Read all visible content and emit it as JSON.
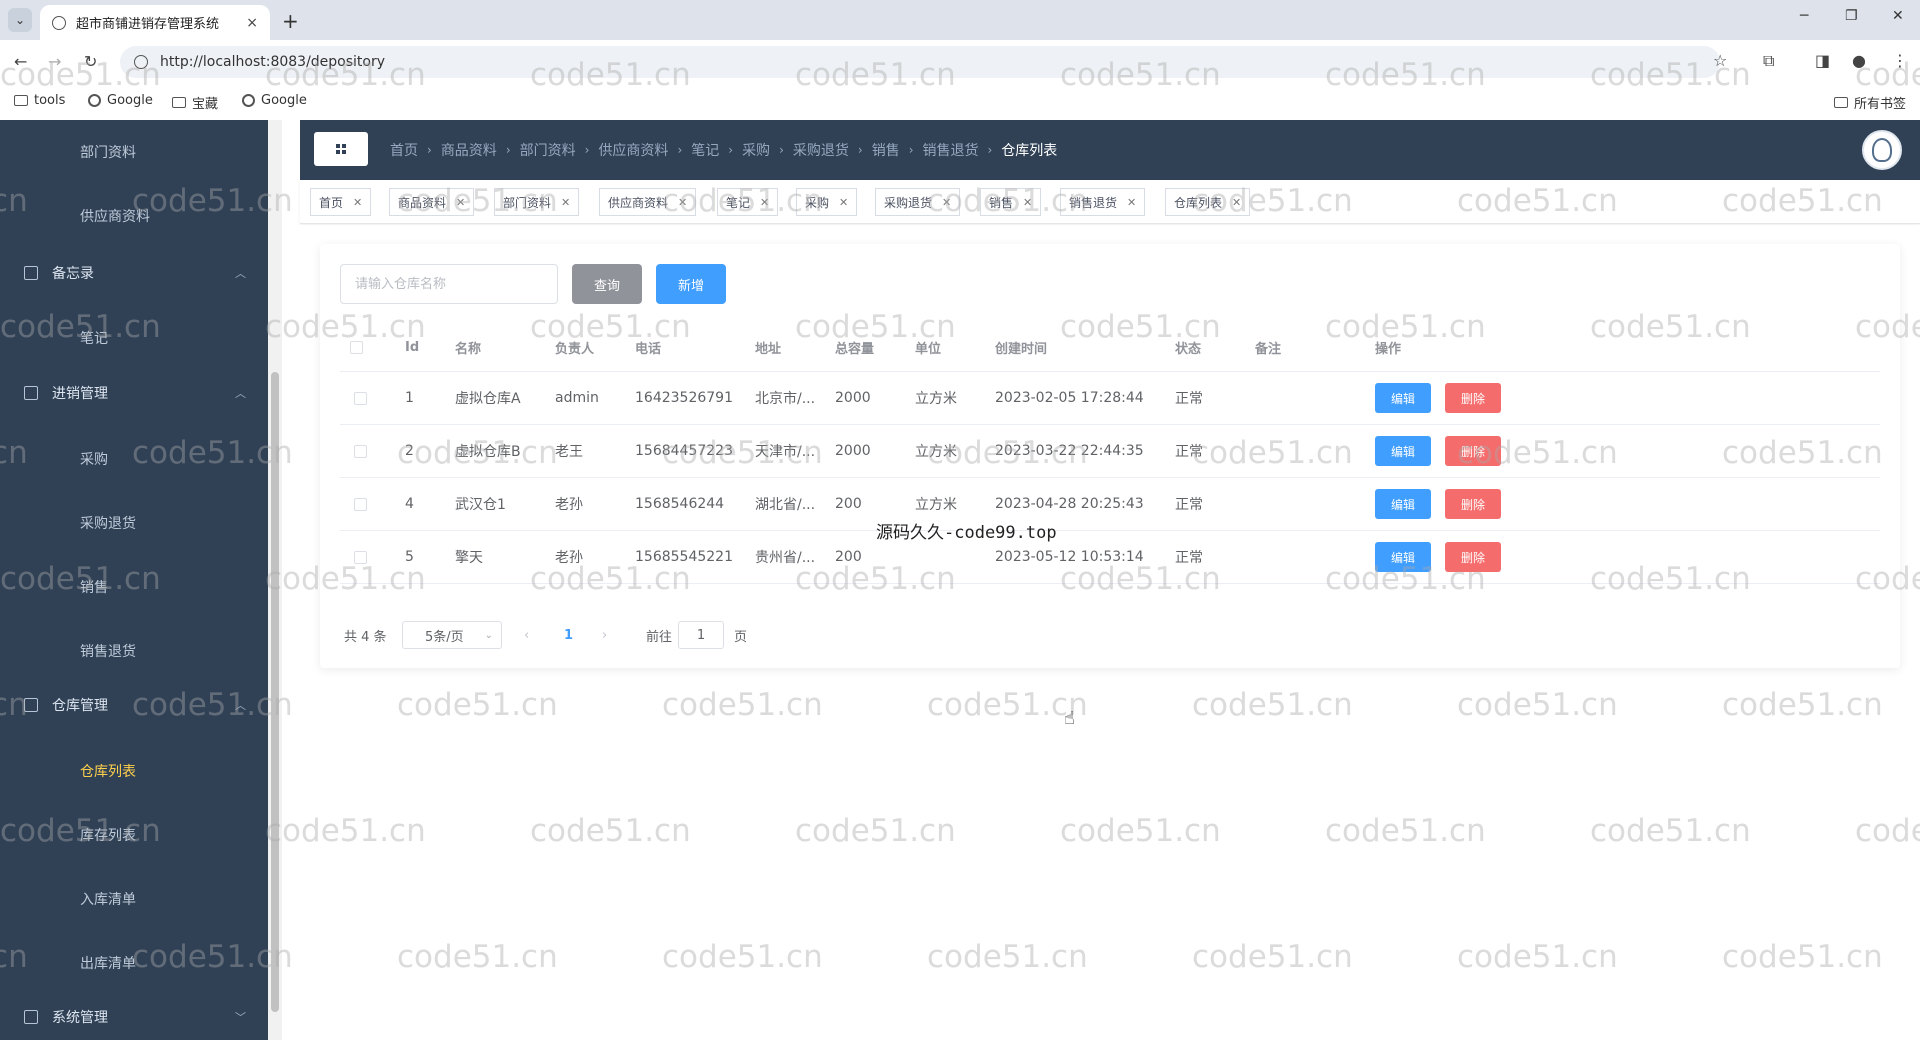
{
  "browser": {
    "tab_title": "超市商铺进销存管理系统",
    "tab_close": "×",
    "new_tab": "+",
    "url": "http://localhost:8083/depository",
    "bookmarks": [
      "tools",
      "Google",
      "宝藏",
      "Google"
    ],
    "all_bookmarks": "所有书签",
    "window_controls": [
      "─",
      "❐",
      "✕"
    ]
  },
  "sidebar": {
    "items": [
      {
        "label": "部门资料",
        "type": "sub"
      },
      {
        "label": "供应商资料",
        "type": "sub"
      },
      {
        "label": "备忘录",
        "type": "group"
      },
      {
        "label": "笔记",
        "type": "sub"
      },
      {
        "label": "进销管理",
        "type": "group"
      },
      {
        "label": "采购",
        "type": "sub"
      },
      {
        "label": "采购退货",
        "type": "sub"
      },
      {
        "label": "销售",
        "type": "sub"
      },
      {
        "label": "销售退货",
        "type": "sub"
      },
      {
        "label": "仓库管理",
        "type": "group"
      },
      {
        "label": "仓库列表",
        "type": "sub",
        "active": true
      },
      {
        "label": "库存列表",
        "type": "sub"
      },
      {
        "label": "入库清单",
        "type": "sub"
      },
      {
        "label": "出库清单",
        "type": "sub"
      },
      {
        "label": "系统管理",
        "type": "group"
      }
    ],
    "active_color": "#ffd04b"
  },
  "breadcrumb": [
    "首页",
    "商品资料",
    "部门资料",
    "供应商资料",
    "笔记",
    "采购",
    "采购退货",
    "销售",
    "销售退货",
    "仓库列表"
  ],
  "tags": [
    "首页",
    "商品资料",
    "部门资料",
    "供应商资料",
    "笔记",
    "采购",
    "采购退货",
    "销售",
    "销售退货",
    "仓库列表"
  ],
  "toolbar": {
    "search_placeholder": "请输入仓库名称",
    "query_label": "查询",
    "add_label": "新增"
  },
  "table": {
    "columns": [
      "Id",
      "名称",
      "负责人",
      "电话",
      "地址",
      "总容量",
      "单位",
      "创建时间",
      "状态",
      "备注",
      "操作"
    ],
    "rows": [
      {
        "id": "1",
        "name": "虚拟仓库A",
        "manager": "admin",
        "phone": "16423526791",
        "address": "北京市/...",
        "capacity": "2000",
        "unit": "立方米",
        "created": "2023-02-05 17:28:44",
        "status": "正常",
        "remark": ""
      },
      {
        "id": "2",
        "name": "虚拟仓库B",
        "manager": "老王",
        "phone": "15684457223",
        "address": "天津市/...",
        "capacity": "2000",
        "unit": "立方米",
        "created": "2023-03-22 22:44:35",
        "status": "正常",
        "remark": ""
      },
      {
        "id": "4",
        "name": "武汉仓1",
        "manager": "老孙",
        "phone": "1568546244",
        "address": "湖北省/...",
        "capacity": "200",
        "unit": "立方米",
        "created": "2023-04-28 20:25:43",
        "status": "正常",
        "remark": ""
      },
      {
        "id": "5",
        "name": "擎天",
        "manager": "老孙",
        "phone": "15685545221",
        "address": "贵州省/...",
        "capacity": "200",
        "unit": "",
        "created": "2023-05-12 10:53:14",
        "status": "正常",
        "remark": ""
      }
    ],
    "edit_label": "编辑",
    "delete_label": "删除"
  },
  "pagination": {
    "total": "共 4 条",
    "page_size": "5条/页",
    "current_page": "1",
    "goto_label": "前往",
    "goto_value": "1",
    "page_unit": "页"
  },
  "watermark": {
    "text": "code51.cn",
    "center_text": "源码久久-code99.top"
  },
  "colors": {
    "sidebar_bg": "#304156",
    "primary": "#409eff",
    "danger": "#f56c6c",
    "info": "#909399"
  }
}
